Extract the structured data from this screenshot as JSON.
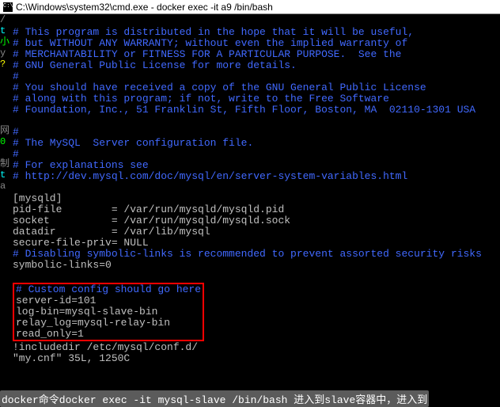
{
  "window": {
    "title": "C:\\Windows\\system32\\cmd.exe - docker  exec -it a9 /bin/bash"
  },
  "gutter": [
    {
      "t": "/",
      "c": "g-gray"
    },
    {
      "t": "t",
      "c": "g-cyan"
    },
    {
      "t": "小",
      "c": "g-green"
    },
    {
      "t": "y",
      "c": "g-gray"
    },
    {
      "t": "?",
      "c": "g-yellow"
    },
    {
      "t": "",
      "c": ""
    },
    {
      "t": "",
      "c": ""
    },
    {
      "t": "",
      "c": ""
    },
    {
      "t": "",
      "c": ""
    },
    {
      "t": "",
      "c": ""
    },
    {
      "t": "网",
      "c": "g-gray"
    },
    {
      "t": "0",
      "c": "g-green"
    },
    {
      "t": "",
      "c": ""
    },
    {
      "t": "制",
      "c": "g-gray"
    },
    {
      "t": "t",
      "c": "g-cyan"
    },
    {
      "t": "a",
      "c": "g-gray"
    }
  ],
  "license": {
    "l1": "# This program is distributed in the hope that it will be useful,",
    "l2": "# but WITHOUT ANY WARRANTY; without even the implied warranty of",
    "l3": "# MERCHANTABILITY or FITNESS FOR A PARTICULAR PURPOSE.  See the",
    "l4": "# GNU General Public License for more details.",
    "l5": "#",
    "l6": "# You should have received a copy of the GNU General Public License",
    "l7": "# along with this program; if not, write to the Free Software",
    "l8": "# Foundation, Inc., 51 Franklin St, Fifth Floor, Boston, MA  02110-1301 USA",
    "l9": "",
    "l10": "#",
    "l11": "# The MySQL  Server configuration file.",
    "l12": "#",
    "l13": "# For explanations see",
    "l14": "# http://dev.mysql.com/doc/mysql/en/server-system-variables.html"
  },
  "mysqld": {
    "header": "[mysqld]",
    "pid": "pid-file        = /var/run/mysqld/mysqld.pid",
    "socket": "socket          = /var/run/mysqld/mysqld.sock",
    "datadir": "datadir         = /var/lib/mysql",
    "secure": "secure-file-priv= NULL",
    "disable": "# Disabling symbolic-links is recommended to prevent assorted security risks",
    "sym": "symbolic-links=0",
    "custom": "# Custom config should go here",
    "sid": "server-id=101",
    "logbin": "log-bin=mysql-slave-bin",
    "relay": "relay_log=mysql-relay-bin",
    "ro": "read_only=1",
    "include": "!includedir /etc/mysql/conf.d/"
  },
  "status": {
    "line": "\"my.cnf\" 35L, 1250C"
  },
  "bottom": {
    "lead": "docker命令docker exec -it mysql-slave /bin/bash 进入到slave容器中，进入到"
  }
}
